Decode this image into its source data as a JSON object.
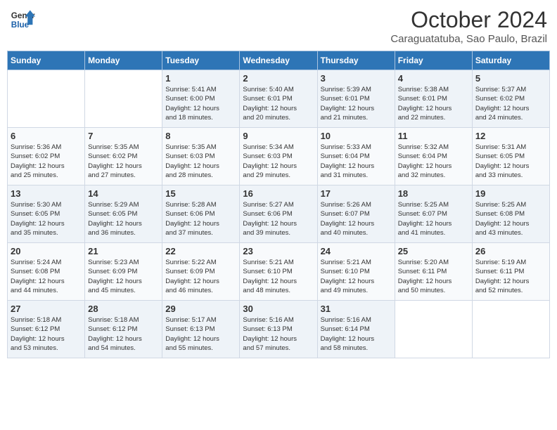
{
  "header": {
    "logo_line1": "General",
    "logo_line2": "Blue",
    "month": "October 2024",
    "location": "Caraguatatuba, Sao Paulo, Brazil"
  },
  "days_of_week": [
    "Sunday",
    "Monday",
    "Tuesday",
    "Wednesday",
    "Thursday",
    "Friday",
    "Saturday"
  ],
  "weeks": [
    [
      {
        "day": "",
        "content": ""
      },
      {
        "day": "",
        "content": ""
      },
      {
        "day": "1",
        "content": "Sunrise: 5:41 AM\nSunset: 6:00 PM\nDaylight: 12 hours\nand 18 minutes."
      },
      {
        "day": "2",
        "content": "Sunrise: 5:40 AM\nSunset: 6:01 PM\nDaylight: 12 hours\nand 20 minutes."
      },
      {
        "day": "3",
        "content": "Sunrise: 5:39 AM\nSunset: 6:01 PM\nDaylight: 12 hours\nand 21 minutes."
      },
      {
        "day": "4",
        "content": "Sunrise: 5:38 AM\nSunset: 6:01 PM\nDaylight: 12 hours\nand 22 minutes."
      },
      {
        "day": "5",
        "content": "Sunrise: 5:37 AM\nSunset: 6:02 PM\nDaylight: 12 hours\nand 24 minutes."
      }
    ],
    [
      {
        "day": "6",
        "content": "Sunrise: 5:36 AM\nSunset: 6:02 PM\nDaylight: 12 hours\nand 25 minutes."
      },
      {
        "day": "7",
        "content": "Sunrise: 5:35 AM\nSunset: 6:02 PM\nDaylight: 12 hours\nand 27 minutes."
      },
      {
        "day": "8",
        "content": "Sunrise: 5:35 AM\nSunset: 6:03 PM\nDaylight: 12 hours\nand 28 minutes."
      },
      {
        "day": "9",
        "content": "Sunrise: 5:34 AM\nSunset: 6:03 PM\nDaylight: 12 hours\nand 29 minutes."
      },
      {
        "day": "10",
        "content": "Sunrise: 5:33 AM\nSunset: 6:04 PM\nDaylight: 12 hours\nand 31 minutes."
      },
      {
        "day": "11",
        "content": "Sunrise: 5:32 AM\nSunset: 6:04 PM\nDaylight: 12 hours\nand 32 minutes."
      },
      {
        "day": "12",
        "content": "Sunrise: 5:31 AM\nSunset: 6:05 PM\nDaylight: 12 hours\nand 33 minutes."
      }
    ],
    [
      {
        "day": "13",
        "content": "Sunrise: 5:30 AM\nSunset: 6:05 PM\nDaylight: 12 hours\nand 35 minutes."
      },
      {
        "day": "14",
        "content": "Sunrise: 5:29 AM\nSunset: 6:05 PM\nDaylight: 12 hours\nand 36 minutes."
      },
      {
        "day": "15",
        "content": "Sunrise: 5:28 AM\nSunset: 6:06 PM\nDaylight: 12 hours\nand 37 minutes."
      },
      {
        "day": "16",
        "content": "Sunrise: 5:27 AM\nSunset: 6:06 PM\nDaylight: 12 hours\nand 39 minutes."
      },
      {
        "day": "17",
        "content": "Sunrise: 5:26 AM\nSunset: 6:07 PM\nDaylight: 12 hours\nand 40 minutes."
      },
      {
        "day": "18",
        "content": "Sunrise: 5:25 AM\nSunset: 6:07 PM\nDaylight: 12 hours\nand 41 minutes."
      },
      {
        "day": "19",
        "content": "Sunrise: 5:25 AM\nSunset: 6:08 PM\nDaylight: 12 hours\nand 43 minutes."
      }
    ],
    [
      {
        "day": "20",
        "content": "Sunrise: 5:24 AM\nSunset: 6:08 PM\nDaylight: 12 hours\nand 44 minutes."
      },
      {
        "day": "21",
        "content": "Sunrise: 5:23 AM\nSunset: 6:09 PM\nDaylight: 12 hours\nand 45 minutes."
      },
      {
        "day": "22",
        "content": "Sunrise: 5:22 AM\nSunset: 6:09 PM\nDaylight: 12 hours\nand 46 minutes."
      },
      {
        "day": "23",
        "content": "Sunrise: 5:21 AM\nSunset: 6:10 PM\nDaylight: 12 hours\nand 48 minutes."
      },
      {
        "day": "24",
        "content": "Sunrise: 5:21 AM\nSunset: 6:10 PM\nDaylight: 12 hours\nand 49 minutes."
      },
      {
        "day": "25",
        "content": "Sunrise: 5:20 AM\nSunset: 6:11 PM\nDaylight: 12 hours\nand 50 minutes."
      },
      {
        "day": "26",
        "content": "Sunrise: 5:19 AM\nSunset: 6:11 PM\nDaylight: 12 hours\nand 52 minutes."
      }
    ],
    [
      {
        "day": "27",
        "content": "Sunrise: 5:18 AM\nSunset: 6:12 PM\nDaylight: 12 hours\nand 53 minutes."
      },
      {
        "day": "28",
        "content": "Sunrise: 5:18 AM\nSunset: 6:12 PM\nDaylight: 12 hours\nand 54 minutes."
      },
      {
        "day": "29",
        "content": "Sunrise: 5:17 AM\nSunset: 6:13 PM\nDaylight: 12 hours\nand 55 minutes."
      },
      {
        "day": "30",
        "content": "Sunrise: 5:16 AM\nSunset: 6:13 PM\nDaylight: 12 hours\nand 57 minutes."
      },
      {
        "day": "31",
        "content": "Sunrise: 5:16 AM\nSunset: 6:14 PM\nDaylight: 12 hours\nand 58 minutes."
      },
      {
        "day": "",
        "content": ""
      },
      {
        "day": "",
        "content": ""
      }
    ]
  ]
}
